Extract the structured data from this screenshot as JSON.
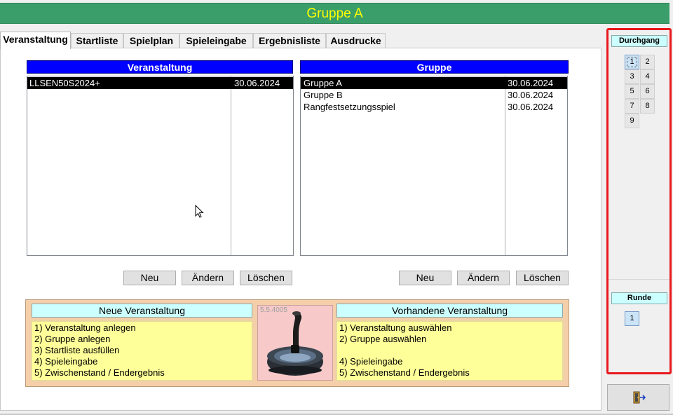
{
  "window": {
    "title": "Gruppe A"
  },
  "tabs": [
    {
      "label": "Veranstaltung",
      "active": true
    },
    {
      "label": "Startliste"
    },
    {
      "label": "Spielplan"
    },
    {
      "label": "Spieleingabe"
    },
    {
      "label": "Ergebnisliste"
    },
    {
      "label": "Ausdrucke"
    }
  ],
  "events": {
    "header": "Veranstaltung",
    "rows": [
      {
        "name": "LLSEN50S2024+",
        "date": "30.06.2024",
        "selected": true
      }
    ],
    "buttons": {
      "new": "Neu",
      "edit": "Ändern",
      "delete": "Löschen"
    }
  },
  "groups": {
    "header": "Gruppe",
    "rows": [
      {
        "name": "Gruppe A",
        "date": "30.06.2024",
        "selected": true
      },
      {
        "name": "Gruppe B",
        "date": "30.06.2024"
      },
      {
        "name": "Rangfestsetzungsspiel",
        "date": "30.06.2024"
      }
    ],
    "buttons": {
      "new": "Neu",
      "edit": "Ändern",
      "delete": "Löschen"
    }
  },
  "info": {
    "new_event": {
      "header": "Neue Veranstaltung",
      "steps": [
        "1) Veranstaltung anlegen",
        "2) Gruppe anlegen",
        "3) Startliste ausfüllen",
        "4) Spieleingabe",
        "5) Zwischenstand / Endergebnis"
      ]
    },
    "existing_event": {
      "header": "Vorhandene Veranstaltung",
      "steps": [
        "1) Veranstaltung auswählen",
        "2) Gruppe auswählen",
        "",
        "4) Spieleingabe",
        "5) Zwischenstand / Endergebnis"
      ]
    },
    "version": "5.5.4005"
  },
  "sidebar": {
    "durchgang_label": "Durchgang",
    "durchgang": [
      "1",
      "2",
      "3",
      "4",
      "5",
      "6",
      "7",
      "8",
      "9"
    ],
    "durchgang_active": "1",
    "runde_label": "Runde",
    "runde": [
      "1"
    ],
    "runde_active": "1"
  },
  "icons": {
    "exit": "exit-door-icon",
    "logo": "curling-stone-logo"
  },
  "colors": {
    "title_bg": "#3a9e6a",
    "title_text": "#ffff00",
    "list_header": "#0000ff",
    "highlight_frame": "#e8181c"
  }
}
